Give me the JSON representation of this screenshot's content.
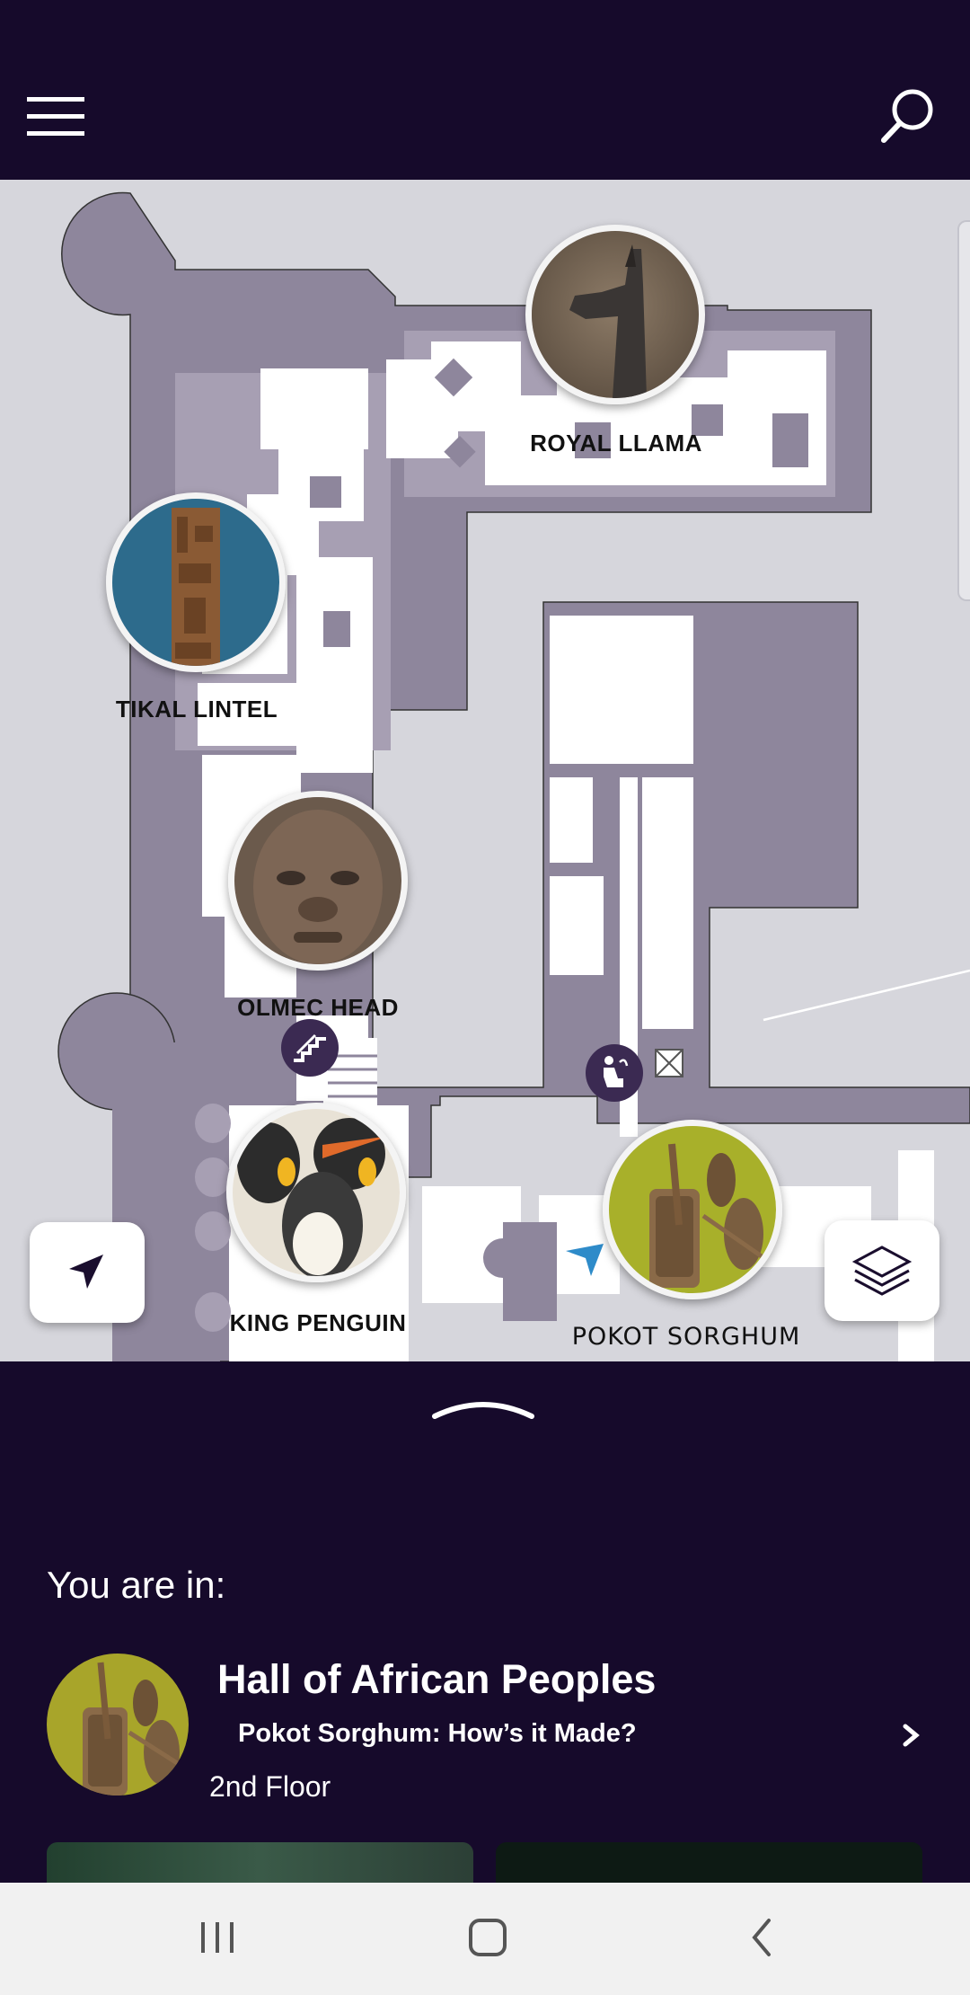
{
  "header": {
    "menu_icon": "hamburger-menu-icon",
    "search_icon": "search-icon"
  },
  "map": {
    "pois": [
      {
        "id": "royal-llama",
        "label": "ROYAL LLAMA"
      },
      {
        "id": "tikal-lintel",
        "label": "TIKAL LINTEL"
      },
      {
        "id": "olmec-head",
        "label": "OLMEC HEAD"
      },
      {
        "id": "king-penguin",
        "label": "KING PENGUIN"
      },
      {
        "id": "pokot-sorghum",
        "label": "POKOT SORGHUM"
      }
    ],
    "icons": [
      "stairs-icon",
      "water-fountain-icon",
      "user-location-arrow-icon"
    ],
    "locate_button_icon": "navigation-arrow-icon",
    "layers_button_icon": "layers-icon"
  },
  "sheet": {
    "you_are_in": "You are in:",
    "hall": "Hall of African Peoples",
    "exhibit": "Pokot Sorghum: How’s it Made?",
    "floor": "2nd Floor"
  },
  "colors": {
    "header_bg": "#160a2b",
    "map_bg": "#d6d6dc",
    "floor_plan": "#8e869c",
    "room": "#ffffff",
    "accent_arrow": "#2e8bc9"
  },
  "system_nav": [
    "recent-apps-icon",
    "home-icon",
    "back-icon"
  ]
}
